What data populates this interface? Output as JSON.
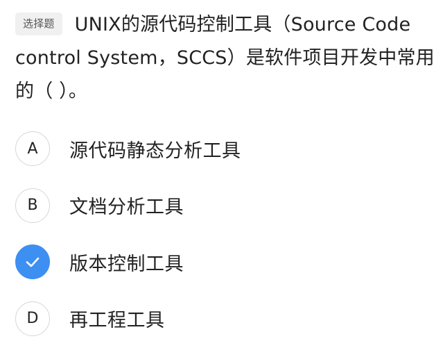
{
  "question": {
    "badge": "选择题",
    "text": "UNIX的源代码控制工具（Source Code control System，SCCS）是软件项目开发中常用的（ ）。"
  },
  "options": [
    {
      "marker": "A",
      "text": "源代码静态分析工具",
      "selected": false
    },
    {
      "marker": "B",
      "text": "文档分析工具",
      "selected": false
    },
    {
      "marker": "check-icon",
      "text": "版本控制工具",
      "selected": true
    },
    {
      "marker": "D",
      "text": "再工程工具",
      "selected": false
    }
  ],
  "colors": {
    "accent": "#3d8ff2",
    "badge_bg": "#f0f0f0",
    "text": "#222222"
  }
}
